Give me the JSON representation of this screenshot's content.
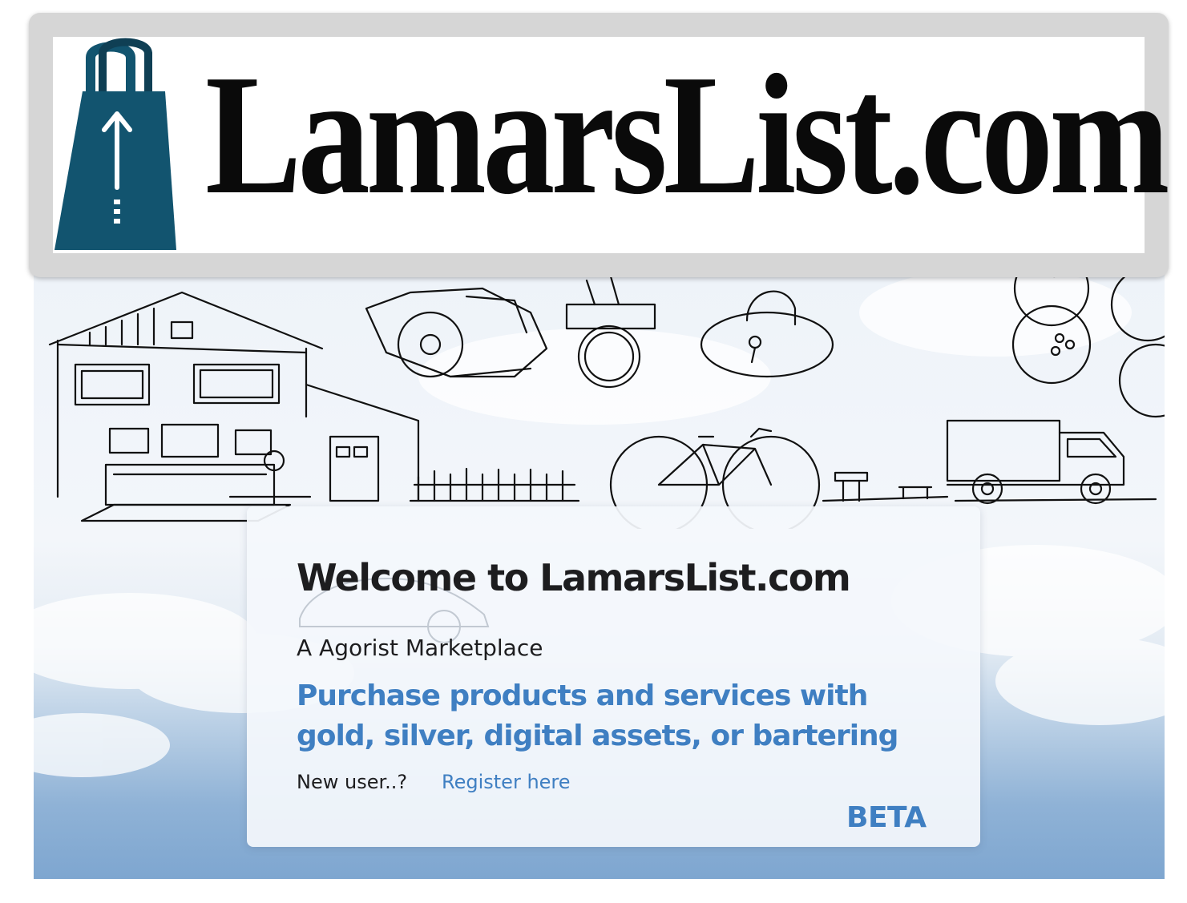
{
  "brand": {
    "site_name": "LamarsList.com",
    "logo_color": "#12546f"
  },
  "card": {
    "welcome": "Welcome to LamarsList.com",
    "subtitle": "A Agorist Marketplace",
    "tagline": "Purchase products and services with gold, silver, digital assets, or bartering",
    "new_user_prompt": "New user..?",
    "register_link": "Register here",
    "badge": "BETA"
  },
  "colors": {
    "accent": "#3f7fc2",
    "text": "#1d1d1f",
    "sky": "#7ea6d0"
  },
  "illustration": {
    "items": [
      "house-sketch",
      "circular-saw-sketch",
      "coin-stamp-sketch",
      "padlock-sketch",
      "balls-sketch",
      "bicycle-sketch",
      "truck-sketch",
      "fence-sketch"
    ]
  }
}
